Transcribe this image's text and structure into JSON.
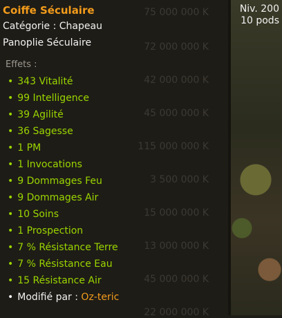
{
  "item": {
    "name": "Coiffe Séculaire",
    "category": "Catégorie : Chapeau",
    "set": "Panoplie Séculaire",
    "level": "Niv. 200",
    "weight": "10 pods"
  },
  "effects_label": "Effets :",
  "effects": [
    "343 Vitalité",
    "99 Intelligence",
    "39 Agilité",
    "36 Sagesse",
    "1 PM",
    "1 Invocations",
    "9 Dommages Feu",
    "9 Dommages Air",
    "10 Soins",
    "1 Prospection",
    "7 % Résistance Terre",
    "7 % Résistance Eau",
    "15 Résistance Air"
  ],
  "modified": {
    "label": "Modifié par :",
    "author": "Oz-teric"
  },
  "background_prices": [
    "75 000 000 K",
    "72 000 000 K",
    "42 000 000 K",
    "45 000 000 K",
    "115 000 000 K",
    "3 500 000 K",
    "15 000 000 K",
    "13 000 000 K",
    "45 000 000 K",
    "22 000 000 K"
  ],
  "colors": {
    "title": "#f39c1b",
    "effect": "#9bd600",
    "text": "#f2f2f2",
    "muted": "#9a988f",
    "background": "#1e1c17"
  }
}
